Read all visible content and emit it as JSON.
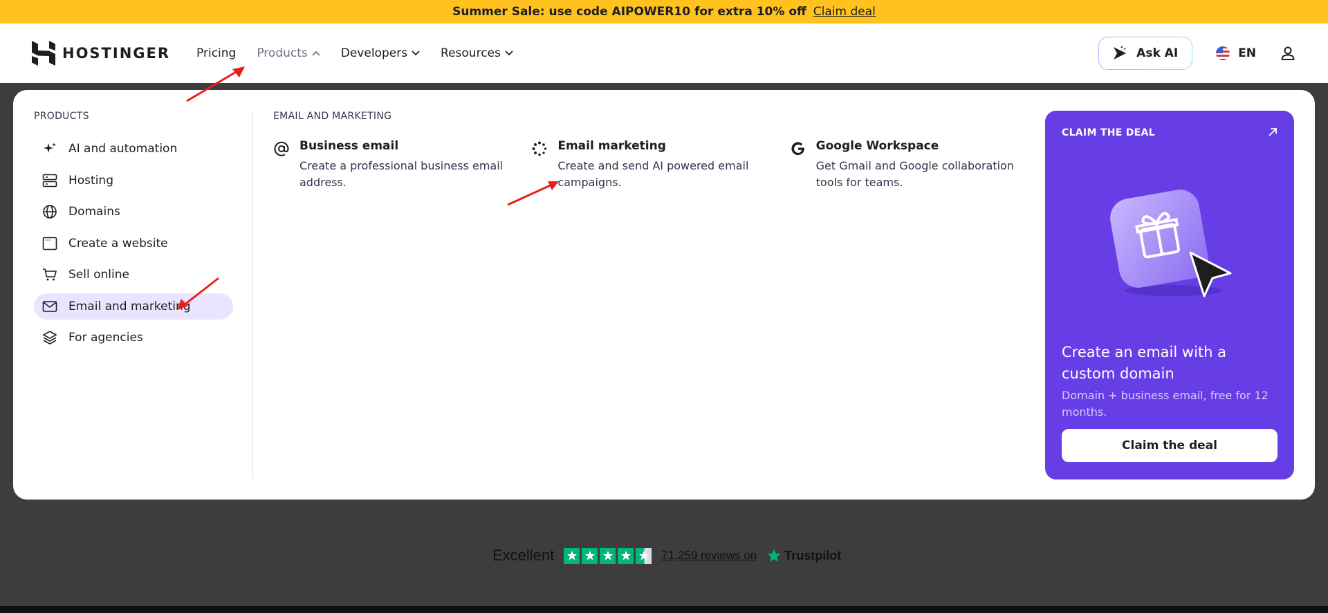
{
  "promo": {
    "text": "Summer Sale: use code AIPOWER10 for extra 10% off",
    "link": "Claim deal"
  },
  "header": {
    "logo_text": "HOSTINGER",
    "nav": [
      {
        "label": "Pricing"
      },
      {
        "label": "Products"
      },
      {
        "label": "Developers"
      },
      {
        "label": "Resources"
      }
    ],
    "ask_ai_label": "Ask AI",
    "language": "EN"
  },
  "panel": {
    "products_title": "PRODUCTS",
    "menu": [
      {
        "label": "AI and automation",
        "icon": "sparkle-icon"
      },
      {
        "label": "Hosting",
        "icon": "server-icon"
      },
      {
        "label": "Domains",
        "icon": "globe-icon"
      },
      {
        "label": "Create a website",
        "icon": "browser-window-icon"
      },
      {
        "label": "Sell online",
        "icon": "cart-icon"
      },
      {
        "label": "Email and marketing",
        "icon": "mail-icon",
        "selected": true
      },
      {
        "label": "For agencies",
        "icon": "layers-icon"
      }
    ],
    "section_title": "EMAIL AND MARKETING",
    "cards": [
      {
        "title": "Business email",
        "desc": "Create a professional business email address.",
        "icon": "at-icon"
      },
      {
        "title": "Email marketing",
        "desc": "Create and send AI powered email campaigns.",
        "icon": "loader-icon"
      },
      {
        "title": "Google Workspace",
        "desc": "Get Gmail and Google collaboration tools for teams.",
        "icon": "google-icon"
      }
    ],
    "deal": {
      "label": "CLAIM THE DEAL",
      "title": "Create an email with a custom domain",
      "desc": "Domain + business email, free for 12 months.",
      "button": "Claim the deal"
    }
  },
  "trustpilot": {
    "rating_word": "Excellent",
    "stars": 4.5,
    "reviews": "71,259 reviews on",
    "brand": "Trustpilot"
  },
  "colors": {
    "accent": "#673de6",
    "banner": "#ffc21f",
    "selected_bg": "#ebe4ff",
    "annotation": "#e8201a"
  }
}
